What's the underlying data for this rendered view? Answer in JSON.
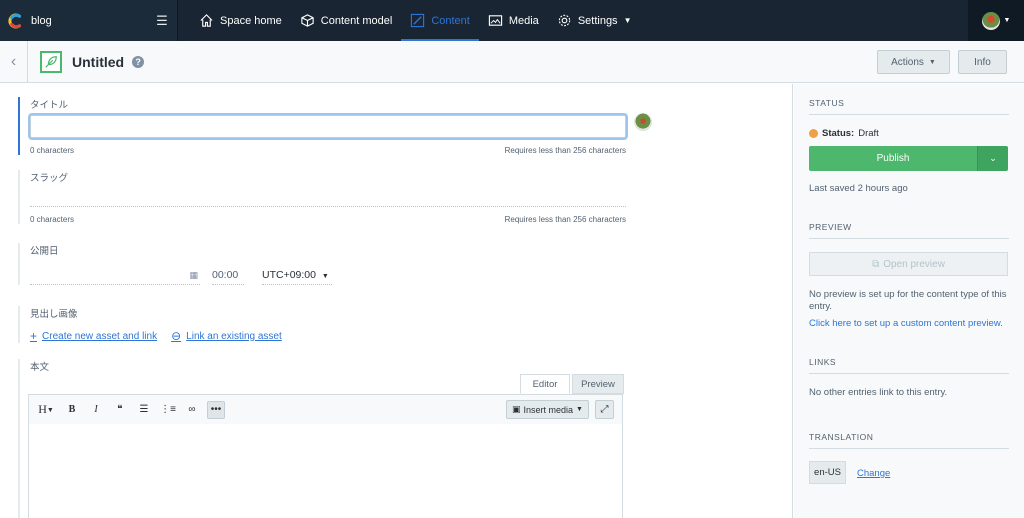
{
  "topbar": {
    "space_name": "blog",
    "nav": [
      "Space home",
      "Content model",
      "Content",
      "Media",
      "Settings"
    ]
  },
  "header": {
    "title": "Untitled",
    "help": "?",
    "actions_label": "Actions",
    "info_label": "Info"
  },
  "fields": {
    "title": {
      "label": "タイトル",
      "count": "0 characters",
      "limit": "Requires less than 256 characters"
    },
    "slug": {
      "label": "スラッグ",
      "count": "0 characters",
      "limit": "Requires less than 256 characters"
    },
    "date": {
      "label": "公開日",
      "time": "00:00",
      "timezone": "UTC+09:00"
    },
    "image": {
      "label": "見出し画像",
      "create_link": "Create new asset and link",
      "existing_link": "Link an existing asset"
    },
    "body": {
      "label": "本文",
      "tab_editor": "Editor",
      "tab_preview": "Preview",
      "tools": [
        "H",
        "B",
        "I",
        "❝",
        "list",
        "numbered-list",
        "link",
        "more"
      ],
      "insert_media": "Insert media"
    }
  },
  "sidebar": {
    "status_title": "STATUS",
    "status_label": "Status:",
    "status_value": "Draft",
    "publish_label": "Publish",
    "last_saved": "Last saved 2 hours ago",
    "preview_title": "PREVIEW",
    "open_preview": "Open preview",
    "preview_note": "No preview is set up for the content type of this entry.",
    "preview_link": "Click here to set up a custom content preview.",
    "links_title": "LINKS",
    "links_note": "No other entries link to this entry.",
    "translation_title": "TRANSLATION",
    "locale": "en-US",
    "change_label": "Change"
  },
  "colors": {
    "nav_bg": "#192532",
    "accent": "#2e75d4",
    "publish": "#4cb76d",
    "draft": "#f09f44"
  }
}
